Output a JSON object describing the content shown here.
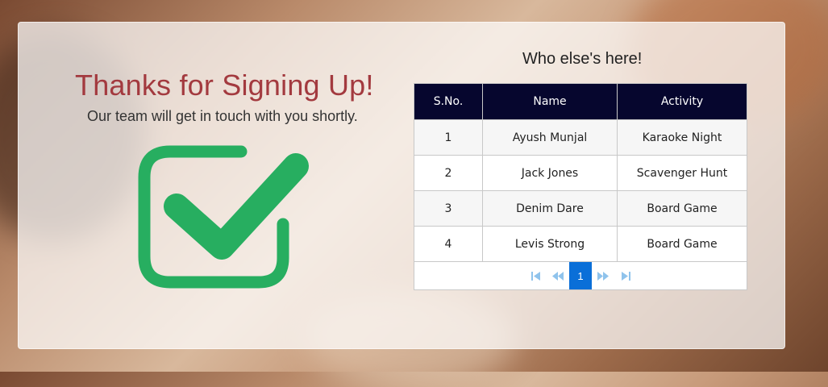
{
  "signup": {
    "headline": "Thanks for Signing Up!",
    "subline": "Our team will get in touch with you shortly.",
    "check_color": "#27ae60"
  },
  "participants": {
    "title": "Who else's here!",
    "columns": [
      "S.No.",
      "Name",
      "Activity"
    ],
    "rows": [
      [
        "1",
        "Ayush Munjal",
        "Karaoke Night"
      ],
      [
        "2",
        "Jack Jones",
        "Scavenger Hunt"
      ],
      [
        "3",
        "Denim Dare",
        "Board Game"
      ],
      [
        "4",
        "Levis Strong",
        "Board Game"
      ]
    ],
    "pagination": {
      "current_page": "1",
      "first_icon": "first-page-icon",
      "prev_icon": "previous-page-icon",
      "next_icon": "next-page-icon",
      "last_icon": "last-page-icon"
    }
  },
  "colors": {
    "header_bg": "#06062e",
    "headline": "#a33a3f",
    "pager_active": "#0a6fd8"
  }
}
